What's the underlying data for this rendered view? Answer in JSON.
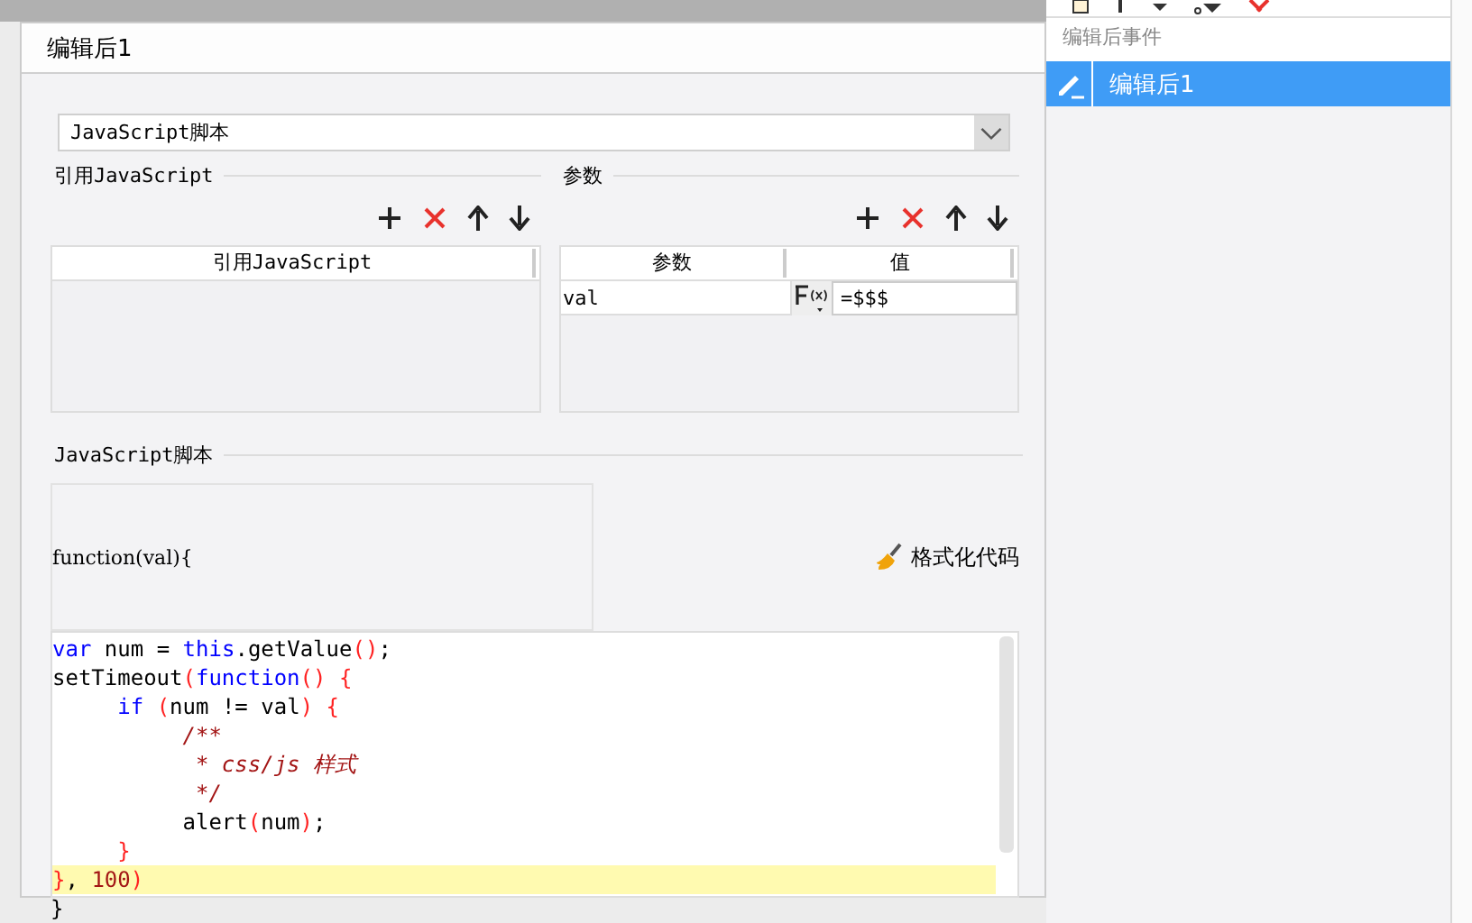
{
  "dialog": {
    "title": "编辑后1",
    "script_type": "JavaScript脚本",
    "ref_section": {
      "title": "引用JavaScript",
      "column": "引用JavaScript"
    },
    "params_section": {
      "title": "参数",
      "columns": [
        "参数",
        "值"
      ],
      "rows": [
        {
          "name": "val",
          "value": "=$$$"
        }
      ]
    },
    "script_section": {
      "title": "JavaScript脚本",
      "header": "function(val){",
      "format_button": "格式化代码",
      "code_lines": [
        {
          "text": "var num = this.getValue();",
          "current": false
        },
        {
          "text": "setTimeout(function() {",
          "current": false
        },
        {
          "text": "     if (num != val) {",
          "current": false
        },
        {
          "text": "          /**",
          "current": false
        },
        {
          "text": "           * css/js 样式",
          "current": false
        },
        {
          "text": "           */",
          "current": false
        },
        {
          "text": "          alert(num);",
          "current": false
        },
        {
          "text": "     }",
          "current": false
        },
        {
          "text": "}, 100)",
          "current": true
        }
      ],
      "footer": "}"
    }
  },
  "side_panel": {
    "heading": "编辑后事件",
    "items": [
      {
        "label": "编辑后1",
        "selected": true
      }
    ]
  }
}
